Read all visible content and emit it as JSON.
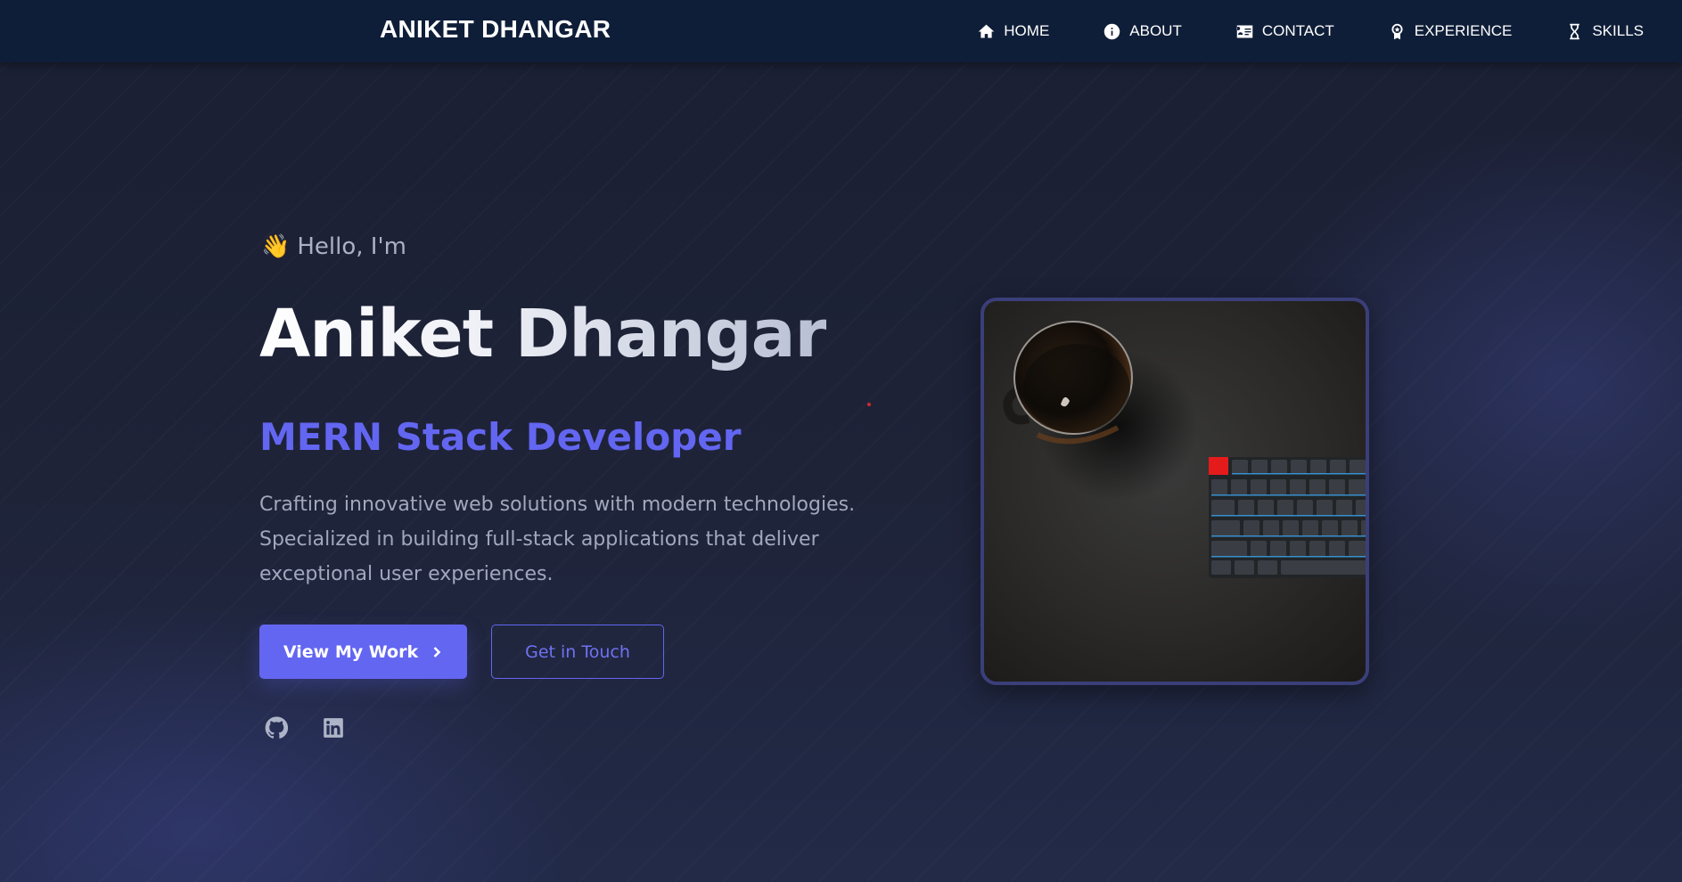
{
  "navbar": {
    "brand": "ANIKET DHANGAR",
    "items": [
      {
        "label": "HOME",
        "icon": "home-icon"
      },
      {
        "label": "ABOUT",
        "icon": "info-icon"
      },
      {
        "label": "CONTACT",
        "icon": "contact-card-icon"
      },
      {
        "label": "EXPERIENCE",
        "icon": "award-icon"
      },
      {
        "label": "SKILLS",
        "icon": "hourglass-icon"
      }
    ]
  },
  "hero": {
    "greeting_emoji": "👋",
    "greeting": "Hello, I'm",
    "name": "Aniket Dhangar",
    "role": "MERN Stack Developer",
    "description_lines": [
      "Crafting innovative web solutions with modern technologies.",
      "Specialized in building full-stack applications that deliver",
      "exceptional user experiences."
    ],
    "primary_button": "View My Work",
    "secondary_button": "Get in Touch",
    "socials": [
      "github-icon",
      "linkedin-icon"
    ],
    "image_icon": "coffee-mug-and-keyboard-photo"
  },
  "colors": {
    "navbar_bg": "#0f1e38",
    "page_bg": "#1c2136",
    "accent": "#6366f1",
    "text_muted": "#a2a8bc"
  }
}
